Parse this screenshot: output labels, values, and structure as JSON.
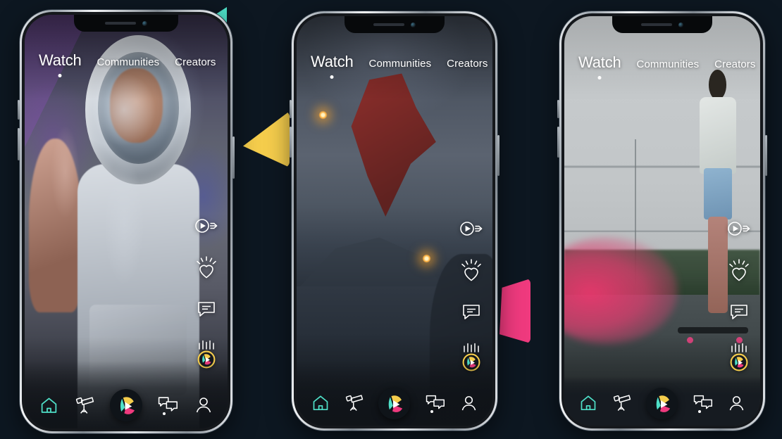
{
  "app": {
    "background_color": "#0d1721",
    "brand_colors": {
      "teal": "#4fe0c8",
      "yellow": "#f5cd4c",
      "pink": "#ef3a7e"
    }
  },
  "shapes": [
    {
      "name": "teal-triangle",
      "color": "#4fe0c8"
    },
    {
      "name": "yellow-triangle",
      "color": "#f5cd4c"
    },
    {
      "name": "pink-quad",
      "color": "#ef3a7e"
    }
  ],
  "top_nav": {
    "tabs": [
      {
        "label": "Watch",
        "active": true
      },
      {
        "label": "Communities",
        "active": false
      },
      {
        "label": "Creators",
        "active": false
      }
    ]
  },
  "action_rail": [
    {
      "name": "share-icon",
      "label": "Share"
    },
    {
      "name": "like-heart-icon",
      "label": "Like"
    },
    {
      "name": "comment-icon",
      "label": "Comment"
    },
    {
      "name": "boost-badge-icon",
      "label": "Boost"
    }
  ],
  "bottom_nav": {
    "items": [
      {
        "name": "home",
        "label": "Home",
        "active": true
      },
      {
        "name": "discover",
        "label": "Discover",
        "active": false
      },
      {
        "name": "create",
        "label": "Create",
        "active": false,
        "is_fab": true
      },
      {
        "name": "messages",
        "label": "Messages",
        "active": false,
        "has_badge": true
      },
      {
        "name": "profile",
        "label": "Profile",
        "active": false
      }
    ]
  },
  "phones": [
    {
      "id": "phone-1",
      "scene": "astronaut-birthday-video",
      "screen_theme": "dark"
    },
    {
      "id": "phone-2",
      "scene": "fire-dancer-flip-at-dusk-video",
      "screen_theme": "dark"
    },
    {
      "id": "phone-3",
      "scene": "skateboarder-pink-smoke-video",
      "screen_theme": "light"
    }
  ]
}
